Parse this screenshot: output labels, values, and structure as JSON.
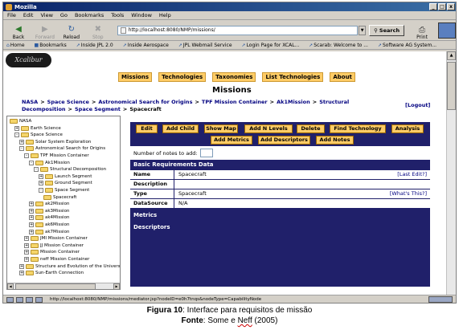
{
  "window": {
    "title": "Mozilla",
    "controls": [
      "_",
      "□",
      "x"
    ]
  },
  "menu": [
    "File",
    "Edit",
    "View",
    "Go",
    "Bookmarks",
    "Tools",
    "Window",
    "Help"
  ],
  "toolbar": {
    "back": "Back",
    "forward": "Forward",
    "reload": "Reload",
    "stop": "Stop",
    "address": "http://localhost:8080/NMP/missions/",
    "search": "Search",
    "print": "Print"
  },
  "bookmarks": [
    "Home",
    "Bookmarks",
    "Inside JPL 2.0",
    "Inside Aerospace",
    "JPL Webmail Service",
    "Login Page for XCAL...",
    "Scarab: Welcome to ...",
    "Software AG System..."
  ],
  "site": {
    "logo": "Xcalibur",
    "nav": [
      "Missions",
      "Technologies",
      "Taxonomies",
      "List Technologies",
      "About"
    ],
    "page_title": "Missions",
    "breadcrumb": [
      "NASA",
      "Space Science",
      "Astronomical Search for Origins",
      "TPF Mission Container",
      "Ak1Mission",
      "Structural Decomposition",
      "Space Segment",
      "Spacecraft"
    ],
    "logout": "[Logout]"
  },
  "tree": [
    {
      "label": "NASA",
      "level": 0,
      "exp": ""
    },
    {
      "label": "Earth Science",
      "level": 1,
      "exp": "+"
    },
    {
      "label": "Space Science",
      "level": 1,
      "exp": "-"
    },
    {
      "label": "Solar System Exploration",
      "level": 2,
      "exp": "+"
    },
    {
      "label": "Astronomical Search for Origins",
      "level": 2,
      "exp": "-"
    },
    {
      "label": "TPF Mission Container",
      "level": 3,
      "exp": "-"
    },
    {
      "label": "Ak1Mission",
      "level": 4,
      "exp": "-"
    },
    {
      "label": "Structural Decomposition",
      "level": 5,
      "exp": "-"
    },
    {
      "label": "Launch Segment",
      "level": 6,
      "exp": "+"
    },
    {
      "label": "Ground Segment",
      "level": 6,
      "exp": "+"
    },
    {
      "label": "Space Segment",
      "level": 6,
      "exp": "-"
    },
    {
      "label": "Spacecraft",
      "level": 7,
      "exp": ""
    },
    {
      "label": "ak2Mission",
      "level": 4,
      "exp": "+"
    },
    {
      "label": "ak3Mission",
      "level": 4,
      "exp": "+"
    },
    {
      "label": "ak4Mission",
      "level": 4,
      "exp": "+"
    },
    {
      "label": "ak6Mission",
      "level": 4,
      "exp": "+"
    },
    {
      "label": "ak7Mission",
      "level": 4,
      "exp": "+"
    },
    {
      "label": "JMI Mission Container",
      "level": 3,
      "exp": "+"
    },
    {
      "label": "JJ Mission Container",
      "level": 3,
      "exp": "+"
    },
    {
      "label": "Mission Container",
      "level": 3,
      "exp": "+"
    },
    {
      "label": "neff Mission Container",
      "level": 3,
      "exp": "+"
    },
    {
      "label": "Structure and Evolution of the Univers",
      "level": 2,
      "exp": "+"
    },
    {
      "label": "Sun-Earth Connection",
      "level": 2,
      "exp": "+"
    }
  ],
  "actions": {
    "row1": [
      "Edit",
      "Add Child",
      "Show Map",
      "Add N Levels",
      "Delete",
      "Find Technology",
      "Analysis"
    ],
    "row2": [
      "Add Metrics",
      "Add Descriptors",
      "Add Notes"
    ]
  },
  "notes": {
    "label": "Number of notes to add:",
    "value": ""
  },
  "requirements": {
    "heading": "Basic Requirements Data",
    "rows": [
      {
        "label": "Name",
        "value": "Spacecraft",
        "link": "[Last Edit?]"
      },
      {
        "label": "Description",
        "value": "",
        "link": ""
      },
      {
        "label": "Type",
        "value": "Spacecraft",
        "link": "[What's This?]"
      },
      {
        "label": "DataSource",
        "value": "N/A",
        "link": ""
      }
    ],
    "metrics": "Metrics",
    "descriptors": "Descriptors"
  },
  "status": {
    "url": "http://localhost:8080/NMP/missions/mediator.jsp?nodeID=e0h7tnqs&nodeType=CapabilityNode"
  },
  "caption": {
    "fig_label": "Figura 10",
    "fig_text": ": Interface para requisitos de missão",
    "src_label": "Fonte",
    "src_text_a": ": Some e ",
    "src_name": "Neff",
    "src_text_b": " (2005)"
  }
}
